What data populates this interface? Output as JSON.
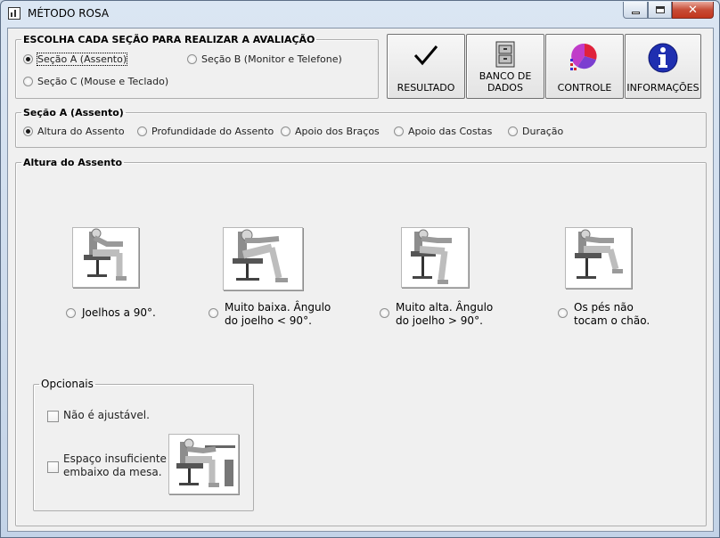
{
  "window": {
    "title": "MÉTODO ROSA",
    "controls": {
      "minimize": "minimize-icon",
      "maximize": "maximize-icon",
      "close": "close-icon"
    }
  },
  "section_select": {
    "legend": "ESCOLHA CADA SEÇÃO PARA REALIZAR A AVALIAÇÃO",
    "options": [
      {
        "label": "Seção A (Assento)",
        "selected": true
      },
      {
        "label": "Seção B (Monitor e Telefone)",
        "selected": false
      },
      {
        "label": "Seção C (Mouse e Teclado)",
        "selected": false
      }
    ]
  },
  "toolbar": [
    {
      "label": "RESULTADO",
      "icon": "checkmark-icon"
    },
    {
      "label": "BANCO DE DADOS",
      "line1": "BANCO DE",
      "line2": "DADOS",
      "icon": "file-cabinet-icon"
    },
    {
      "label": "CONTROLE",
      "icon": "pie-chart-icon"
    },
    {
      "label": "INFORMAÇÕES",
      "icon": "info-icon"
    }
  ],
  "section_a": {
    "legend": "Seção A (Assento)",
    "tabs": [
      {
        "label": "Altura do Assento",
        "selected": true
      },
      {
        "label": "Profundidade do Assento",
        "selected": false
      },
      {
        "label": "Apoio dos Braços",
        "selected": false
      },
      {
        "label": "Apoio das Costas",
        "selected": false
      },
      {
        "label": "Duração",
        "selected": false
      }
    ]
  },
  "seat_height": {
    "legend": "Altura do Assento",
    "options": [
      {
        "line1": "Joelhos a 90°.",
        "line2": "",
        "selected": false
      },
      {
        "line1": "Muito baixa. Ângulo",
        "line2": "do joelho < 90°.",
        "selected": false
      },
      {
        "line1": "Muito alta. Ângulo",
        "line2": "do joelho > 90°.",
        "selected": false
      },
      {
        "line1": "Os pés não",
        "line2": "tocam o chão.",
        "selected": false
      }
    ]
  },
  "optional": {
    "legend": "Opcionais",
    "items": [
      {
        "line1": "Não é ajustável.",
        "line2": "",
        "checked": false
      },
      {
        "line1": "Espaço insuficiente",
        "line2": "embaixo da mesa.",
        "checked": false
      }
    ]
  }
}
